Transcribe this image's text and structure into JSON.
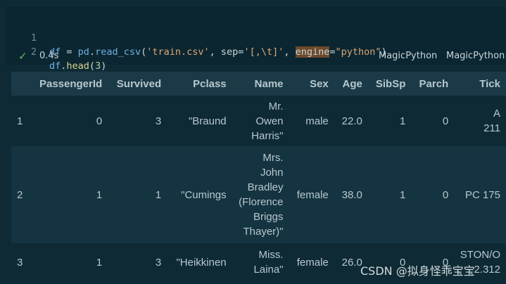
{
  "code": {
    "lines": [
      {
        "num": "1"
      },
      {
        "num": "2"
      }
    ],
    "line1": {
      "var": "df",
      "eq": " = ",
      "obj": "pd",
      "dot": ".",
      "func": "read_csv",
      "open": "(",
      "arg1": "'train.csv'",
      "comma": ", ",
      "kw": "sep",
      "eq2": "=",
      "arg2": "'[,\\t]'",
      "comma2": ", ",
      "kw2": "engine",
      "eq3": "=",
      "arg3": "\"python\"",
      "close": ")"
    },
    "line2": {
      "var": "df",
      "dot": ".",
      "func": "head",
      "open": "(",
      "num": "3",
      "close": ")"
    }
  },
  "status": {
    "icon": "check-icon",
    "time": "0.4s",
    "tag1": "MagicPython",
    "tag2": "MagicPython"
  },
  "table": {
    "columns": [
      "",
      "PassengerId",
      "Survived",
      "Pclass",
      "Name",
      "Sex",
      "Age",
      "SibSp",
      "Parch",
      "Tick"
    ],
    "rows": [
      [
        "1",
        "0",
        "3",
        "\"Braund",
        "Mr.\nOwen\nHarris\"",
        "male",
        "22.0",
        "1",
        "0",
        "A\n211"
      ],
      [
        "2",
        "1",
        "1",
        "\"Cumings",
        "Mrs.\nJohn\nBradley\n(Florence\nBriggs\nThayer)\"",
        "female",
        "38.0",
        "1",
        "0",
        "PC 175"
      ],
      [
        "3",
        "1",
        "3",
        "\"Heikkinen",
        "Miss.\nLaina\"",
        "female",
        "26.0",
        "0",
        "0",
        "STON/O\n2.312"
      ]
    ]
  },
  "watermark": "CSDN @拟身怪乖宝宝"
}
